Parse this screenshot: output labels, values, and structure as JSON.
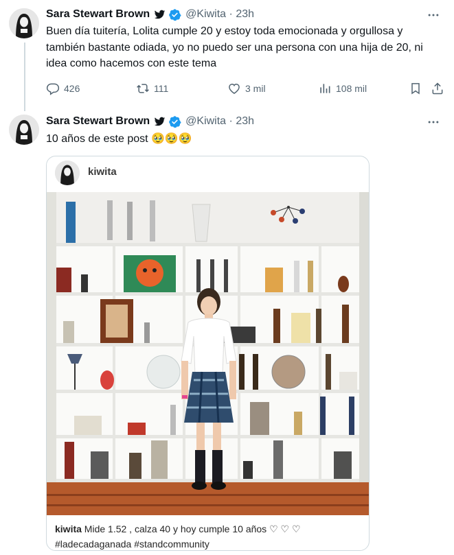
{
  "tweets": [
    {
      "author_name": "Sara Stewart Brown",
      "handle": "@Kiwita",
      "separator": "·",
      "time": "23h",
      "text": "Buen día tuitería, Lolita cumple 20 y estoy toda emocionada y orgullosa y también bastante odiada, yo no puedo ser una persona con una hija de 20, ni idea como hacemos con este tema",
      "stats": {
        "replies": "426",
        "retweets": "111",
        "likes": "3 mil",
        "views": "108 mil"
      }
    },
    {
      "author_name": "Sara Stewart Brown",
      "handle": "@Kiwita",
      "separator": "·",
      "time": "23h",
      "text": "10 años de este post 🥹🥹🥹"
    }
  ],
  "embedded_post": {
    "username": "kiwita",
    "caption_user": "kiwita",
    "caption_text": "Mide 1.52 , calza 40 y hoy cumple 10 años ♡ ♡ ♡",
    "caption_tags": "#ladecadaganada #standcommunity"
  },
  "colors": {
    "text": "#0f1419",
    "secondary": "#536471",
    "verified": "#1d9bf0",
    "border": "#cfd9de"
  },
  "icons": [
    "avatar",
    "bird-icon",
    "verified-badge-icon",
    "more-icon",
    "reply-icon",
    "retweet-icon",
    "like-icon",
    "views-icon",
    "bookmark-icon",
    "share-icon"
  ]
}
